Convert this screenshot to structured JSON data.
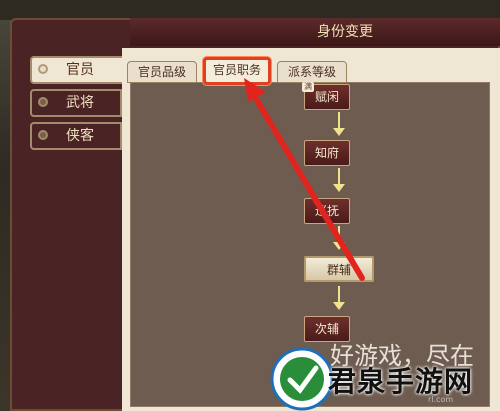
{
  "window": {
    "title": "身份变更"
  },
  "sidebar": {
    "items": [
      {
        "label": "官员",
        "active": true
      },
      {
        "label": "武将",
        "active": false
      },
      {
        "label": "侠客",
        "active": false
      }
    ]
  },
  "tabs": [
    {
      "label": "官员品级",
      "active": false
    },
    {
      "label": "官员职务",
      "active": true
    },
    {
      "label": "派系等级",
      "active": false
    }
  ],
  "flow": {
    "nodes": [
      {
        "label": "赋闲",
        "highlighted": false
      },
      {
        "label": "知府",
        "highlighted": false
      },
      {
        "label": "巡抚",
        "highlighted": false
      },
      {
        "label": "群辅",
        "highlighted": true
      },
      {
        "label": "次辅",
        "highlighted": false
      }
    ],
    "badge": "满"
  },
  "annotation": {
    "color": "#e0251f"
  },
  "watermark": {
    "brand": "君泉手游网",
    "faint": "好游戏，尽在",
    "url": "rl.com"
  },
  "colors": {
    "accent": "#e0401f",
    "panel": "#efe6d4",
    "node": "#5c2424"
  }
}
